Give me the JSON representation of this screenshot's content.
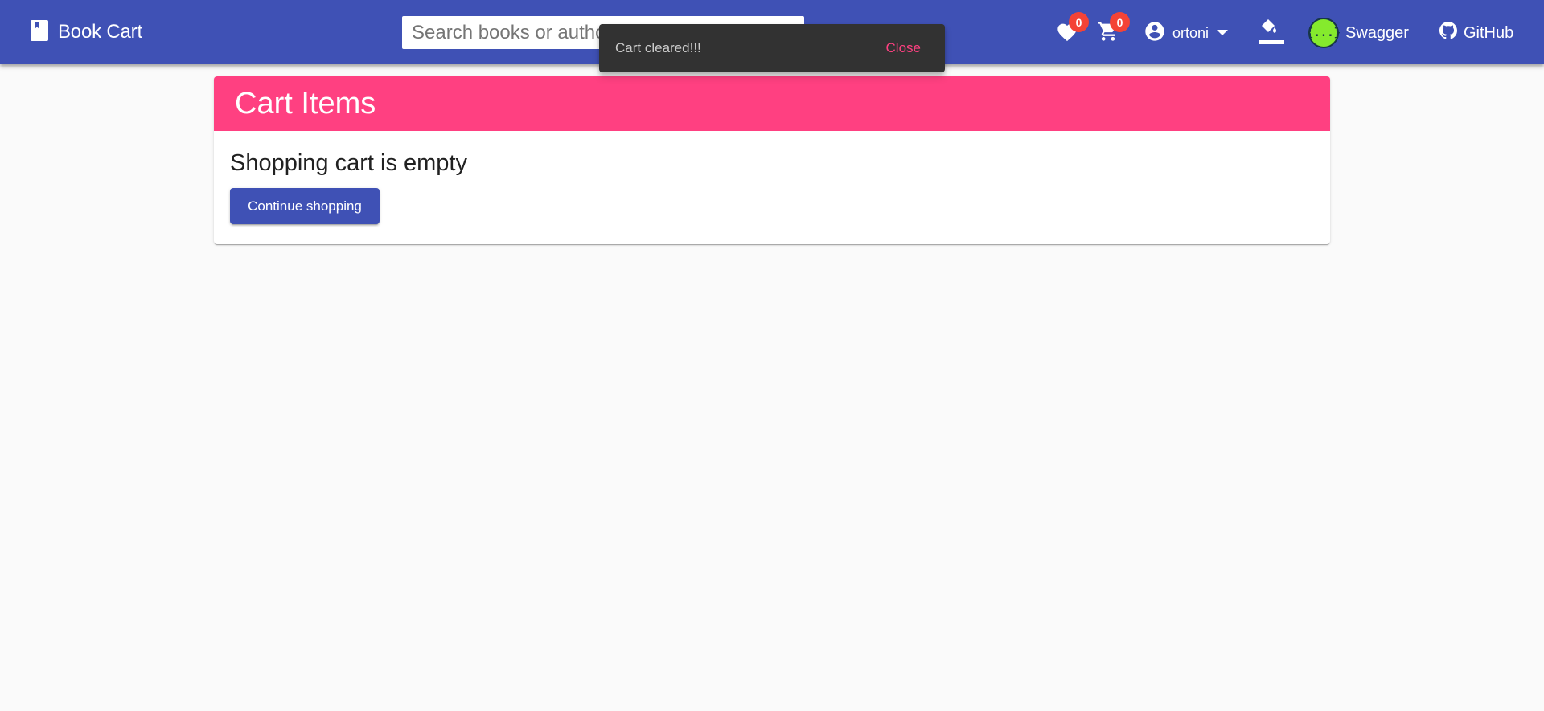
{
  "toolbar": {
    "brand_label": "Book Cart",
    "search_placeholder": "Search books or author",
    "wishlist_count": "0",
    "cart_count": "0",
    "username": "ortoni",
    "swagger_label": "Swagger",
    "swagger_logo_text": "{...}",
    "github_label": "GitHub"
  },
  "snackbar": {
    "message": "Cart cleared!!!",
    "action_label": "Close"
  },
  "cart": {
    "title": "Cart Items",
    "empty_message": "Shopping cart is empty",
    "continue_label": "Continue shopping"
  },
  "colors": {
    "primary": "#3f51b5",
    "accent": "#ff4081",
    "badge": "#f44336",
    "snackbar_bg": "#323232"
  },
  "icons": [
    "book-icon",
    "heart-icon",
    "cart-icon",
    "account-circle-icon",
    "caret-down-icon",
    "paint-bucket-icon",
    "swagger-icon",
    "github-icon"
  ]
}
